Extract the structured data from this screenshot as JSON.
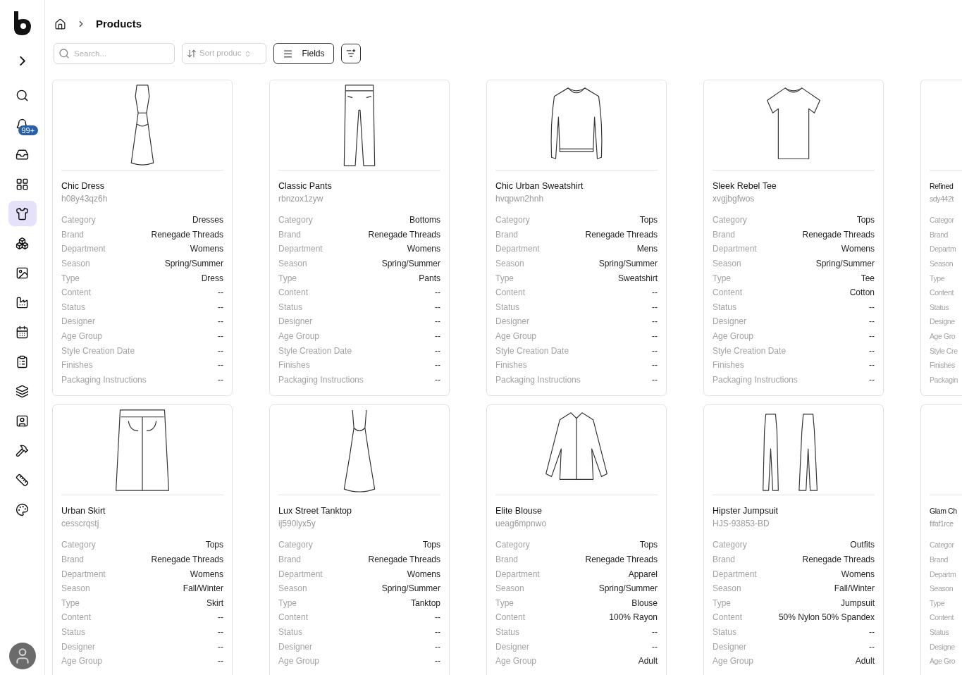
{
  "sidebar": {
    "nav": [
      {
        "selected": false
      },
      {
        "selected": false,
        "badge": "99+"
      },
      {
        "selected": false
      },
      {
        "selected": false
      },
      {
        "selected": true
      },
      {
        "selected": false
      },
      {
        "selected": false
      },
      {
        "selected": false
      },
      {
        "selected": false
      },
      {
        "selected": false
      },
      {
        "selected": false
      },
      {
        "selected": false
      },
      {
        "selected": false
      },
      {
        "selected": false
      },
      {
        "selected": false
      }
    ]
  },
  "breadcrumb": {
    "current": "Products"
  },
  "toolbar": {
    "search": {
      "placeholder": "Search..."
    },
    "sort": {
      "placeholder": "Sort produc"
    },
    "fields_button": "Fields"
  },
  "rows": [
    {
      "products": [
        {
          "name": "Chic Dress",
          "code": "h08y43qz6h",
          "kind": "dress",
          "fields": [
            {
              "label": "Category",
              "value": "Dresses"
            },
            {
              "label": "Brand",
              "value": "Renegade Threads"
            },
            {
              "label": "Department",
              "value": "Womens"
            },
            {
              "label": "Season",
              "value": "Spring/Summer"
            },
            {
              "label": "Type",
              "value": "Dress"
            },
            {
              "label": "Content",
              "value": "--"
            },
            {
              "label": "Status",
              "value": "--"
            },
            {
              "label": "Designer",
              "value": "--"
            },
            {
              "label": "Age Group",
              "value": "--"
            },
            {
              "label": "Style Creation Date",
              "value": "--"
            },
            {
              "label": "Finishes",
              "value": "--"
            },
            {
              "label": "Packaging Instructions",
              "value": "--"
            }
          ]
        },
        {
          "name": "Classic Pants",
          "code": "rbnzox1zyw",
          "kind": "pants",
          "fields": [
            {
              "label": "Category",
              "value": "Bottoms"
            },
            {
              "label": "Brand",
              "value": "Renegade Threads"
            },
            {
              "label": "Department",
              "value": "Womens"
            },
            {
              "label": "Season",
              "value": "Spring/Summer"
            },
            {
              "label": "Type",
              "value": "Pants"
            },
            {
              "label": "Content",
              "value": "--"
            },
            {
              "label": "Status",
              "value": "--"
            },
            {
              "label": "Designer",
              "value": "--"
            },
            {
              "label": "Age Group",
              "value": "--"
            },
            {
              "label": "Style Creation Date",
              "value": "--"
            },
            {
              "label": "Finishes",
              "value": "--"
            },
            {
              "label": "Packaging Instructions",
              "value": "--"
            }
          ]
        },
        {
          "name": "Chic Urban Sweatshirt",
          "code": "hvqpwn2hnh",
          "kind": "sweatshirt",
          "fields": [
            {
              "label": "Category",
              "value": "Tops"
            },
            {
              "label": "Brand",
              "value": "Renegade Threads"
            },
            {
              "label": "Department",
              "value": "Mens"
            },
            {
              "label": "Season",
              "value": "Spring/Summer"
            },
            {
              "label": "Type",
              "value": "Sweatshirt"
            },
            {
              "label": "Content",
              "value": "--"
            },
            {
              "label": "Status",
              "value": "--"
            },
            {
              "label": "Designer",
              "value": "--"
            },
            {
              "label": "Age Group",
              "value": "--"
            },
            {
              "label": "Style Creation Date",
              "value": "--"
            },
            {
              "label": "Finishes",
              "value": "--"
            },
            {
              "label": "Packaging Instructions",
              "value": "--"
            }
          ]
        },
        {
          "name": "Sleek Rebel Tee",
          "code": "xvgjbgfwos",
          "kind": "tee",
          "fields": [
            {
              "label": "Category",
              "value": "Tops"
            },
            {
              "label": "Brand",
              "value": "Renegade Threads"
            },
            {
              "label": "Department",
              "value": "Womens"
            },
            {
              "label": "Season",
              "value": "Spring/Summer"
            },
            {
              "label": "Type",
              "value": "Tee"
            },
            {
              "label": "Content",
              "value": "Cotton"
            },
            {
              "label": "Status",
              "value": "--"
            },
            {
              "label": "Designer",
              "value": "--"
            },
            {
              "label": "Age Group",
              "value": "--"
            },
            {
              "label": "Style Creation Date",
              "value": "--"
            },
            {
              "label": "Finishes",
              "value": "--"
            },
            {
              "label": "Packaging Instructions",
              "value": "--"
            }
          ]
        },
        {
          "name": "Refined",
          "code": "sdy442t",
          "fields": [
            {
              "label": "Categor"
            },
            {
              "label": "Brand"
            },
            {
              "label": "Departm"
            },
            {
              "label": "Season"
            },
            {
              "label": "Type"
            },
            {
              "label": "Content"
            },
            {
              "label": "Status"
            },
            {
              "label": "Designe"
            },
            {
              "label": "Age Gro"
            },
            {
              "label": "Style Cre"
            },
            {
              "label": "Finishes"
            },
            {
              "label": "Packagin"
            }
          ]
        }
      ]
    },
    {
      "products": [
        {
          "name": "Urban Skirt",
          "code": "cesscrqstj",
          "kind": "skirt",
          "fields": [
            {
              "label": "Category",
              "value": "Tops"
            },
            {
              "label": "Brand",
              "value": "Renegade Threads"
            },
            {
              "label": "Department",
              "value": "Womens"
            },
            {
              "label": "Season",
              "value": "Fall/Winter"
            },
            {
              "label": "Type",
              "value": "Skirt"
            },
            {
              "label": "Content",
              "value": "--"
            },
            {
              "label": "Status",
              "value": "--"
            },
            {
              "label": "Designer",
              "value": "--"
            },
            {
              "label": "Age Group",
              "value": "--"
            }
          ]
        },
        {
          "name": "Lux Street Tanktop",
          "code": "ij590lyx5y",
          "kind": "tanktop",
          "fields": [
            {
              "label": "Category",
              "value": "Tops"
            },
            {
              "label": "Brand",
              "value": "Renegade Threads"
            },
            {
              "label": "Department",
              "value": "Womens"
            },
            {
              "label": "Season",
              "value": "Spring/Summer"
            },
            {
              "label": "Type",
              "value": "Tanktop"
            },
            {
              "label": "Content",
              "value": "--"
            },
            {
              "label": "Status",
              "value": "--"
            },
            {
              "label": "Designer",
              "value": "--"
            },
            {
              "label": "Age Group",
              "value": "--"
            }
          ]
        },
        {
          "name": "Elite Blouse",
          "code": "ueag6mpnwo",
          "kind": "blouse",
          "fields": [
            {
              "label": "Category",
              "value": "Tops"
            },
            {
              "label": "Brand",
              "value": "Renegade Threads"
            },
            {
              "label": "Department",
              "value": "Apparel"
            },
            {
              "label": "Season",
              "value": "Spring/Summer"
            },
            {
              "label": "Type",
              "value": "Blouse"
            },
            {
              "label": "Content",
              "value": "100% Rayon"
            },
            {
              "label": "Status",
              "value": "--"
            },
            {
              "label": "Designer",
              "value": "--"
            },
            {
              "label": "Age Group",
              "value": "Adult"
            }
          ]
        },
        {
          "name": "Hipster Jumpsuit",
          "code": "HJS-93853-BD",
          "kind": "jumpsuit",
          "fields": [
            {
              "label": "Category",
              "value": "Outfits"
            },
            {
              "label": "Brand",
              "value": "Renegade Threads"
            },
            {
              "label": "Department",
              "value": "Womens"
            },
            {
              "label": "Season",
              "value": "Fall/Winter"
            },
            {
              "label": "Type",
              "value": "Jumpsuit"
            },
            {
              "label": "Content",
              "value": "50% Nylon 50% Spandex"
            },
            {
              "label": "Status",
              "value": "--"
            },
            {
              "label": "Designer",
              "value": "--"
            },
            {
              "label": "Age Group",
              "value": "Adult"
            }
          ]
        },
        {
          "name": "Glam Ch",
          "code": "fifaf1rce",
          "fields": [
            {
              "label": "Categor"
            },
            {
              "label": "Brand"
            },
            {
              "label": "Departm"
            },
            {
              "label": "Season"
            },
            {
              "label": "Type"
            },
            {
              "label": "Content"
            },
            {
              "label": "Status"
            },
            {
              "label": "Designe"
            },
            {
              "label": "Age Gro"
            }
          ]
        }
      ]
    }
  ]
}
